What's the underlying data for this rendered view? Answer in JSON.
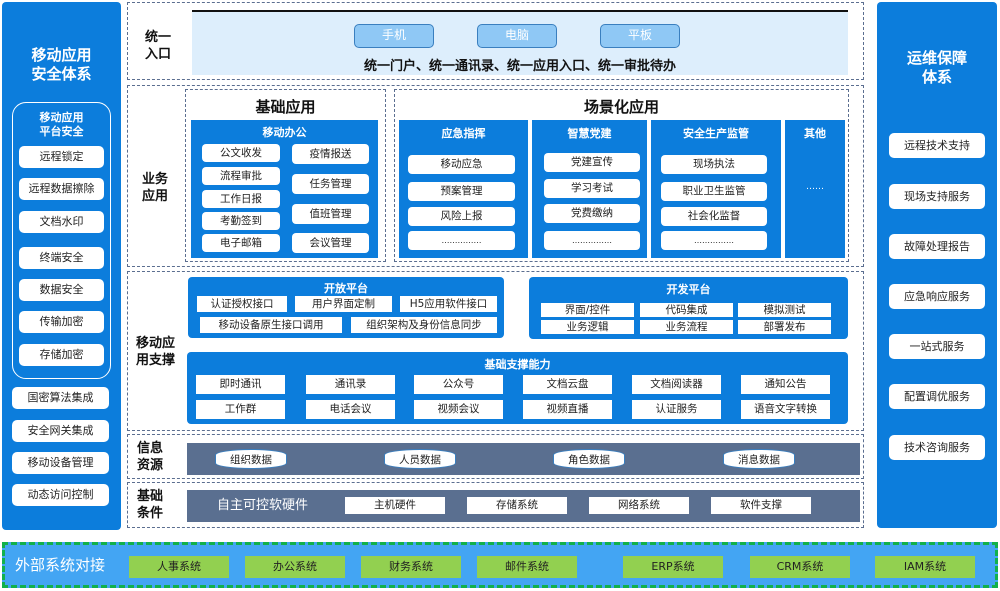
{
  "left_column": {
    "title": [
      "移动应用",
      "安全体系"
    ],
    "platform_security": {
      "title": [
        "移动应用",
        "平台安全"
      ],
      "items": [
        "远程锁定",
        "远程数据擦除",
        "文档水印",
        "终端安全",
        "数据安全",
        "传输加密",
        "存储加密"
      ]
    },
    "items": [
      "国密算法集成",
      "安全网关集成",
      "移动设备管理",
      "动态访问控制"
    ]
  },
  "right_column": {
    "title": [
      "运维保障",
      "体系"
    ],
    "items": [
      "远程技术支持",
      "现场支持服务",
      "故障处理报告",
      "应急响应服务",
      "一站式服务",
      "配置调优服务",
      "技术咨询服务"
    ]
  },
  "unified_entry": {
    "label": [
      "统一",
      "入口"
    ],
    "devices": [
      "手机",
      "电脑",
      "平板"
    ],
    "description": "统一门户、统一通讯录、统一应用入口、统一审批待办"
  },
  "business_apps": {
    "label": [
      "业务",
      "应用"
    ],
    "basic": {
      "title": "基础应用",
      "group_title": "移动办公",
      "left_items": [
        "公文收发",
        "流程审批",
        "工作日报",
        "考勤签到",
        "电子邮箱"
      ],
      "right_items": [
        "疫情报送",
        "任务管理",
        "值班管理",
        "会议管理"
      ]
    },
    "scenario": {
      "title": "场景化应用",
      "groups": [
        {
          "title": "应急指挥",
          "items": [
            "移动应急",
            "预案管理",
            "风险上报",
            "……………"
          ]
        },
        {
          "title": "智慧党建",
          "items": [
            "党建宣传",
            "学习考试",
            "党费缴纳",
            "……………"
          ]
        },
        {
          "title": "安全生产监管",
          "items": [
            "现场执法",
            "职业卫生监管",
            "社会化监督",
            "……………"
          ]
        },
        {
          "title": "其他",
          "items": [
            "……"
          ]
        }
      ]
    }
  },
  "mobile_support": {
    "label": [
      "移动应",
      "用支撑"
    ],
    "open_platform": {
      "title": "开放平台",
      "row1": [
        "认证授权接口",
        "用户界面定制",
        "H5应用软件接口"
      ],
      "row2": [
        "移动设备原生接口调用",
        "组织架构及身份信息同步"
      ]
    },
    "dev_platform": {
      "title": "开发平台",
      "row1": [
        "界面/控件",
        "代码集成",
        "模拟测试"
      ],
      "row2": [
        "业务逻辑",
        "业务流程",
        "部署发布"
      ]
    },
    "basic_capabilities": {
      "title": "基础支撑能力",
      "row1": [
        "即时通讯",
        "通讯录",
        "公众号",
        "文档云盘",
        "文档阅读器",
        "通知公告"
      ],
      "row2": [
        "工作群",
        "电话会议",
        "视频会议",
        "视频直播",
        "认证服务",
        "语音文字转换"
      ]
    }
  },
  "info_resources": {
    "label": [
      "信息",
      "资源"
    ],
    "items": [
      "组织数据",
      "人员数据",
      "角色数据",
      "消息数据"
    ]
  },
  "infrastructure": {
    "label": [
      "基础",
      "条件"
    ],
    "heading": "自主可控软硬件",
    "items": [
      "主机硬件",
      "存储系统",
      "网络系统",
      "软件支撑"
    ]
  },
  "external": {
    "label": "外部系统对接",
    "items": [
      "人事系统",
      "办公系统",
      "财务系统",
      "邮件系统",
      "ERP系统",
      "CRM系统",
      "IAM系统"
    ]
  },
  "colors": {
    "primary_blue": "#0c7ddc",
    "light_blue": "#ddeefc",
    "slate": "#5a6f90",
    "external_band": "#43a5f3",
    "external_item": "#92d050",
    "external_border": "#12b04c"
  }
}
